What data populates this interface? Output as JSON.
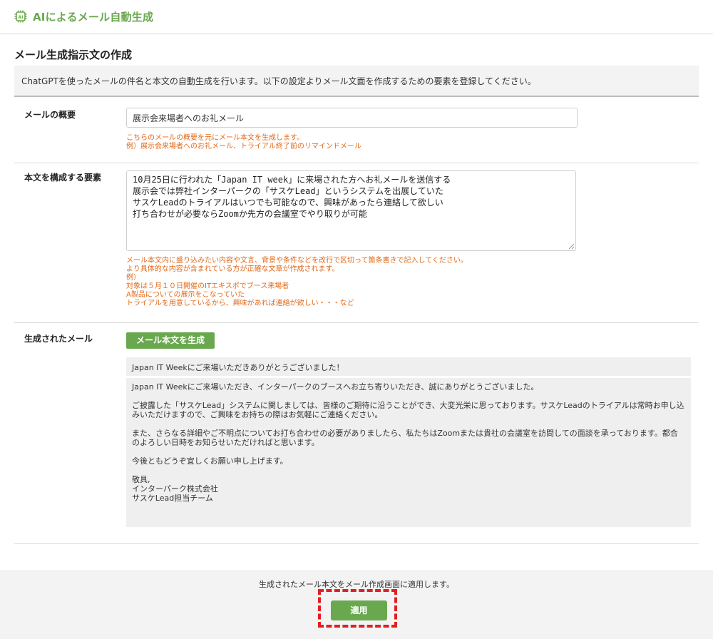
{
  "app": {
    "title": "AIによるメール自動生成",
    "logo_icon": "ai-chip-icon"
  },
  "page": {
    "title": "メール生成指示文の作成",
    "description": "ChatGPTを使ったメールの件名と本文の自動生成を行います。以下の設定よりメール文面を作成するための要素を登録してください。"
  },
  "summary": {
    "label": "メールの概要",
    "value": "展示会来場者へのお礼メール",
    "hint": [
      "こちらのメールの概要を元にメール本文を生成します。",
      "例）展示会来場者へのお礼メール、トライアル終了前のリマインドメール"
    ]
  },
  "elements": {
    "label": "本文を構成する要素",
    "lines": [
      "10月25日に行われた「Japan IT week」に来場された方へお礼メールを送信する",
      "展示会では弊社インターパークの「サスケLead」というシステムを出展していた",
      "サスケLeadのトライアルはいつでも可能なので、興味があったら連絡して欲しい",
      "打ち合わせが必要ならZoomか先方の会議室でやり取りが可能"
    ],
    "hint": [
      "メール本文内に盛り込みたい内容や文言、背景や条件などを改行で区切って箇条書きで記入してください。",
      "より具体的な内容が含まれている方が正確な文章が作成されます。",
      "例）",
      "対象は５月１０日開催のITエキスポでブース来場者",
      "A製品についての展示をこなっていた",
      "トライアルを用意しているから、興味があれば連絡が欲しい・・・など"
    ]
  },
  "generated": {
    "label": "生成されたメール",
    "button_label": "メール本文を生成",
    "subject": "Japan IT Weekにご来場いただきありがとうございました！",
    "paragraphs": [
      "Japan IT Weekにご来場いただき、インターパークのブースへお立ち寄りいただき、誠にありがとうございました。",
      "ご披露した「サスケLead」システムに関しましては、皆様のご期待に沿うことができ、大変光栄に思っております。サスケLeadのトライアルは常時お申し込みいただけますので、ご興味をお持ちの際はお気軽にご連絡ください。",
      "また、さらなる詳細やご不明点についてお打ち合わせの必要がありましたら、私たちはZoomまたは貴社の会議室を訪問しての面談を承っております。都合のよろしい日時をお知らせいただければと思います。",
      "今後ともどうぞ宜しくお願い申し上げます。"
    ],
    "signature": [
      "敬具,",
      "インターパーク株式会社",
      "サスケLead担当チーム"
    ]
  },
  "footer": {
    "note": "生成されたメール本文をメール作成画面に適用します。",
    "apply_label": "適用",
    "highlight_color": "#e02020"
  },
  "colors": {
    "accent": "#6aa84f",
    "hint": "#e06a1a",
    "panel": "#efefef"
  }
}
